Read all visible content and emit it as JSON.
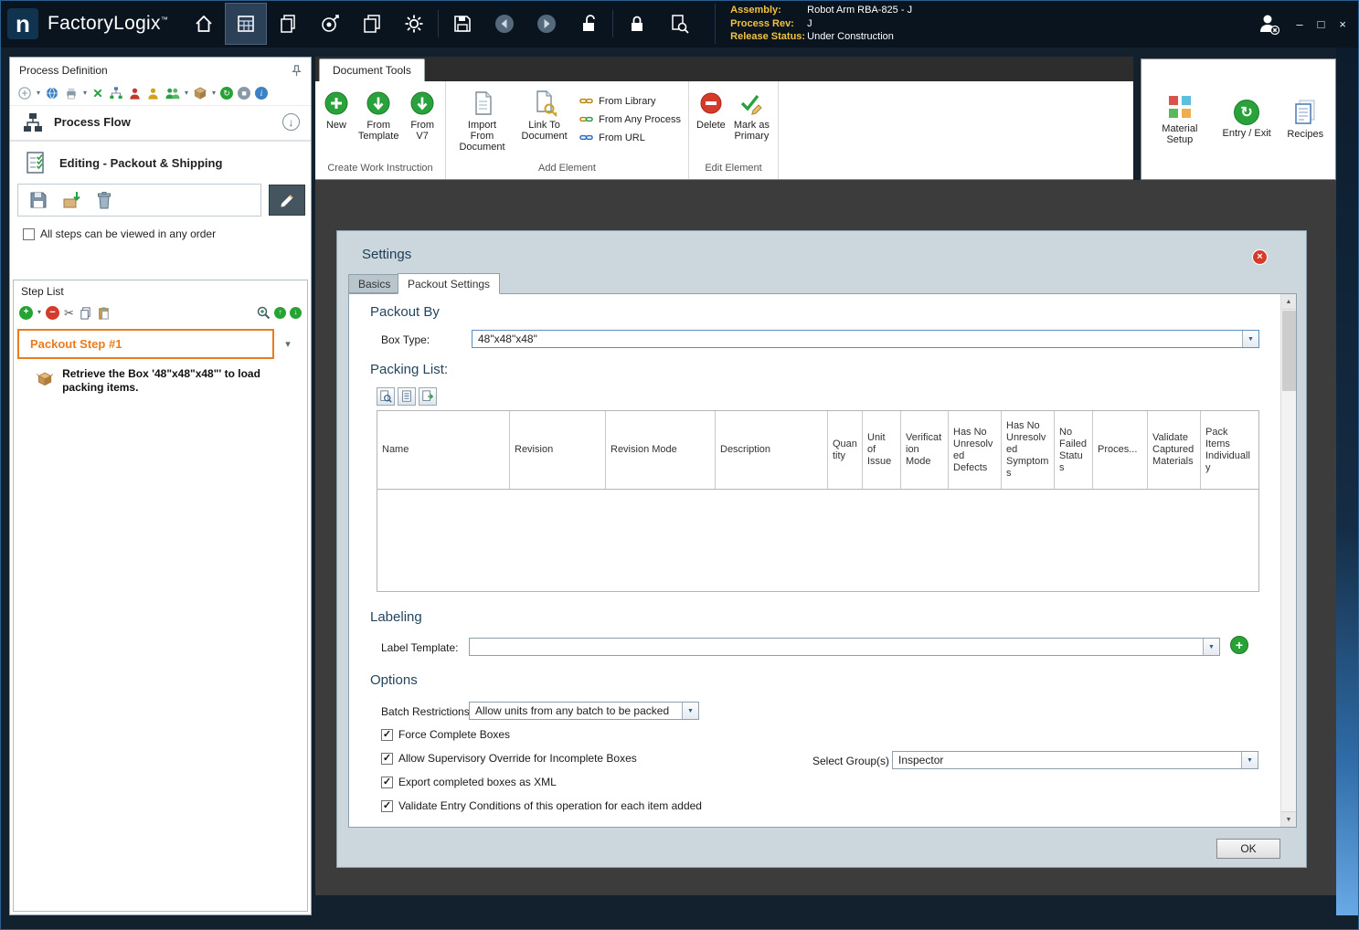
{
  "titlebar": {
    "logo_letter": "n",
    "app_name": "FactoryLogix",
    "trademark": "™",
    "info": {
      "assembly_label": "Assembly:",
      "assembly_value": "Robot Arm RBA-825 - J",
      "process_rev_label": "Process Rev:",
      "process_rev_value": "J",
      "release_status_label": "Release Status:",
      "release_status_value": "Under Construction"
    },
    "window": {
      "minimize": "–",
      "maximize": "□",
      "close": "×"
    }
  },
  "glyphs": {
    "chevron_down": "▾",
    "dropdown_arrow": "▼",
    "scroll_up": "▲",
    "scroll_down": "▼",
    "check": "✓",
    "plus": "+",
    "minus": "−",
    "scissors": "✂",
    "down_arrow": "↓",
    "up_arrow": "↑",
    "refresh": "↻",
    "stop": "■",
    "info_letter": "i",
    "close_x": "×"
  },
  "sidebar": {
    "title": "Process Definition",
    "process_flow_label": "Process Flow",
    "editing_label": "Editing - Packout & Shipping",
    "order_checkbox_label": "All steps can be viewed in any order",
    "order_checkbox_checked": false,
    "step_list": {
      "title": "Step List",
      "active_step_label": "Packout Step #1",
      "step_description": "Retrieve the Box '48\"x48\"x48\"' to load packing items."
    }
  },
  "ribbon": {
    "tab_label": "Document Tools",
    "groups": [
      {
        "label": "Create Work Instruction",
        "items": [
          {
            "label": "New"
          },
          {
            "label": "From Template"
          },
          {
            "label": "From V7"
          }
        ]
      },
      {
        "label": "Add Element",
        "big_items": [
          {
            "label": "Import From Document"
          },
          {
            "label": "Link To Document"
          }
        ],
        "small_items": [
          {
            "label": "From Library"
          },
          {
            "label": "From Any Process"
          },
          {
            "label": "From URL"
          }
        ]
      },
      {
        "label": "Edit Element",
        "items": [
          {
            "label": "Delete"
          },
          {
            "label": "Mark as Primary"
          }
        ]
      }
    ],
    "right_items": [
      {
        "label": "Material Setup"
      },
      {
        "label": "Entry / Exit"
      },
      {
        "label": "Recipes"
      }
    ]
  },
  "settings": {
    "title": "Settings",
    "tabs": [
      {
        "label": "Basics",
        "active": false
      },
      {
        "label": "Packout Settings",
        "active": true
      }
    ],
    "packout_by": {
      "heading": "Packout By",
      "box_type_label": "Box Type:",
      "box_type_value": "48\"x48\"x48\""
    },
    "packing_list": {
      "heading": "Packing List:",
      "columns": [
        "Name",
        "Revision",
        "Revision Mode",
        "Description",
        "Quantity",
        "Unit of Issue",
        "Verification Mode",
        "Has No Unresolved Defects",
        "Has No Unresolved Symptoms",
        "No Failed Status",
        "Proces...",
        "Validate Captured Materials",
        "Pack Items Individually"
      ],
      "rows": []
    },
    "labeling": {
      "heading": "Labeling",
      "label_template_label": "Label Template:",
      "label_template_value": ""
    },
    "options": {
      "heading": "Options",
      "batch_restrictions_label": "Batch Restrictions:",
      "batch_restrictions_value": "Allow units from any batch to be packed",
      "checkboxes": [
        {
          "label": "Force Complete Boxes",
          "checked": true
        },
        {
          "label": "Allow Supervisory Override for Incomplete Boxes",
          "checked": true
        },
        {
          "label": "Export completed boxes as XML",
          "checked": true
        },
        {
          "label": "Validate Entry Conditions of this operation for each item added",
          "checked": true
        }
      ],
      "select_groups_label": "Select Group(s)",
      "select_groups_value": "Inspector"
    },
    "ok_label": "OK"
  }
}
